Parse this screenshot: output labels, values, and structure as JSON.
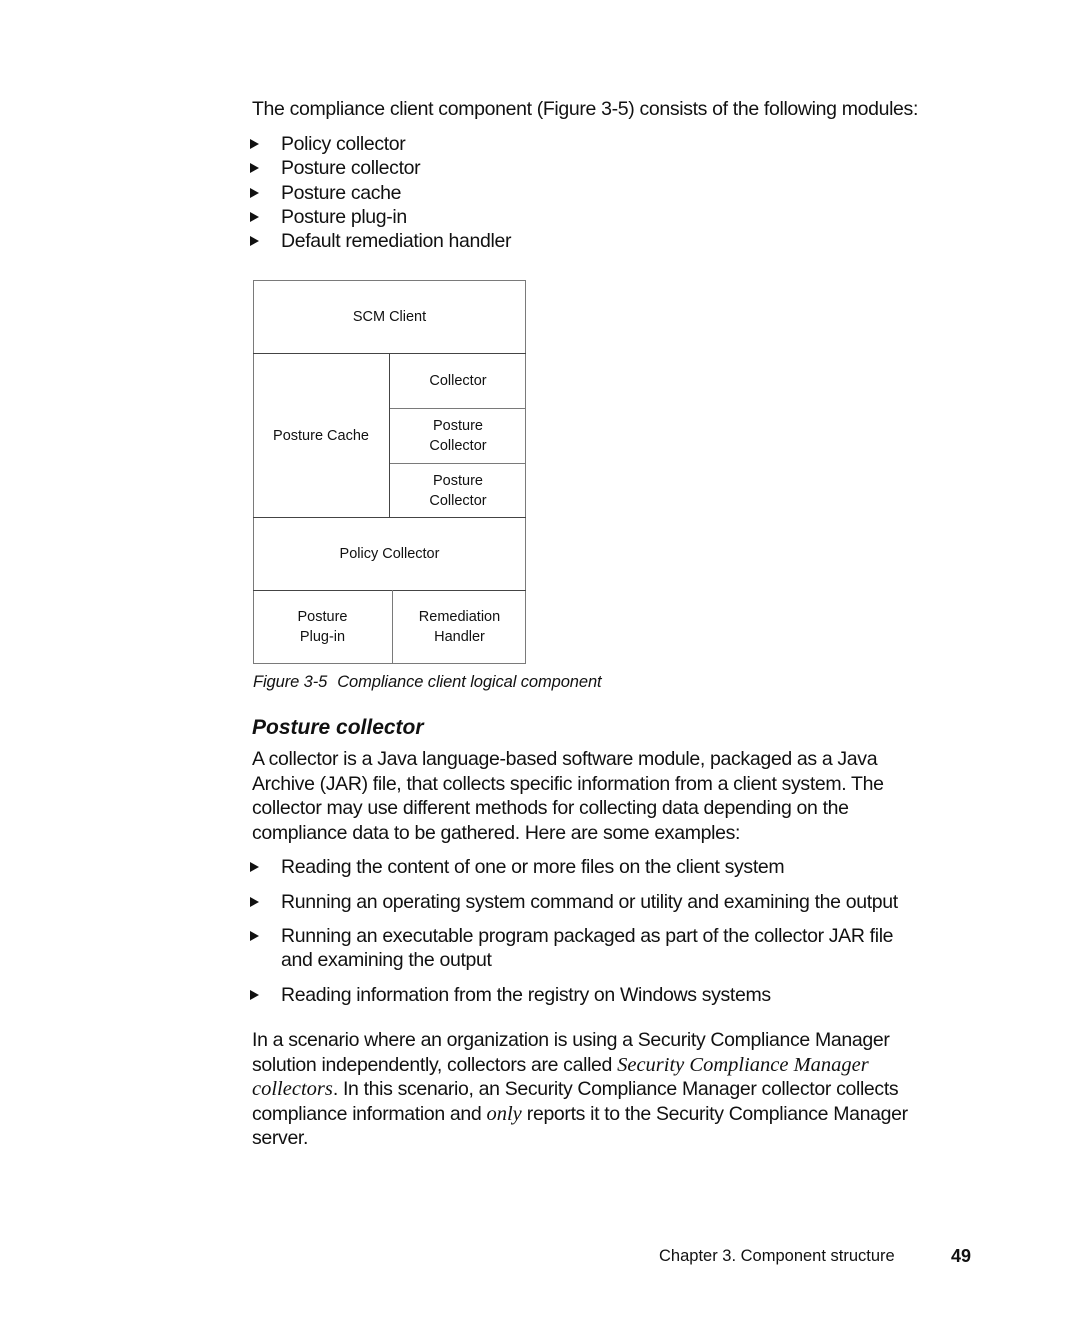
{
  "intro": {
    "text": "The compliance client component (Figure 3-5) consists of the following modules:"
  },
  "modules": [
    {
      "label": "Policy collector"
    },
    {
      "label": "Posture collector"
    },
    {
      "label": "Posture cache"
    },
    {
      "label": "Posture plug-in"
    },
    {
      "label": "Default remediation handler"
    }
  ],
  "figure": {
    "boxes": {
      "scm_client": "SCM Client",
      "posture_cache": "Posture Cache",
      "collector": "Collector",
      "posture_collector_1": [
        "Posture",
        "Collector"
      ],
      "posture_collector_2": [
        "Posture",
        "Collector"
      ],
      "policy_collector": "Policy Collector",
      "posture_plugin": [
        "Posture",
        "Plug-in"
      ],
      "remediation_handler": [
        "Remediation",
        "Handler"
      ]
    },
    "caption_number": "Figure 3-5",
    "caption_title": "Compliance client logical component"
  },
  "section": {
    "heading": "Posture collector",
    "paragraph_lines": [
      "A collector is a Java language-based software module, packaged as a Java",
      "Archive (JAR) file, that collects specific information from a client system. The",
      "collector may use different methods for collecting data depending on the",
      "compliance data to be gathered. Here are some examples:"
    ],
    "examples": [
      {
        "lines": [
          "Reading the content of one or more files on the client system"
        ]
      },
      {
        "lines": [
          "Running an operating system command or utility and examining the output"
        ]
      },
      {
        "lines": [
          "Running an executable program packaged as part of the collector JAR file",
          "and examining the output"
        ]
      },
      {
        "lines": [
          "Reading information from the registry on Windows systems"
        ]
      }
    ],
    "scenario": {
      "line1": "In a scenario where an organization is using a Security Compliance Manager",
      "line2_plain": "solution independently, collectors are called ",
      "line2_italic": "Security Compliance Manager",
      "line3_italic": "collectors",
      "line3_plain": ". In this scenario, an Security Compliance Manager collector collects",
      "line4_plain_a": "compliance information and ",
      "line4_italic": "only",
      "line4_plain_b": " reports it to the Security Compliance Manager",
      "line5": "server."
    }
  },
  "footer": {
    "chapter": "Chapter 3. Component structure",
    "page_number": "49"
  }
}
